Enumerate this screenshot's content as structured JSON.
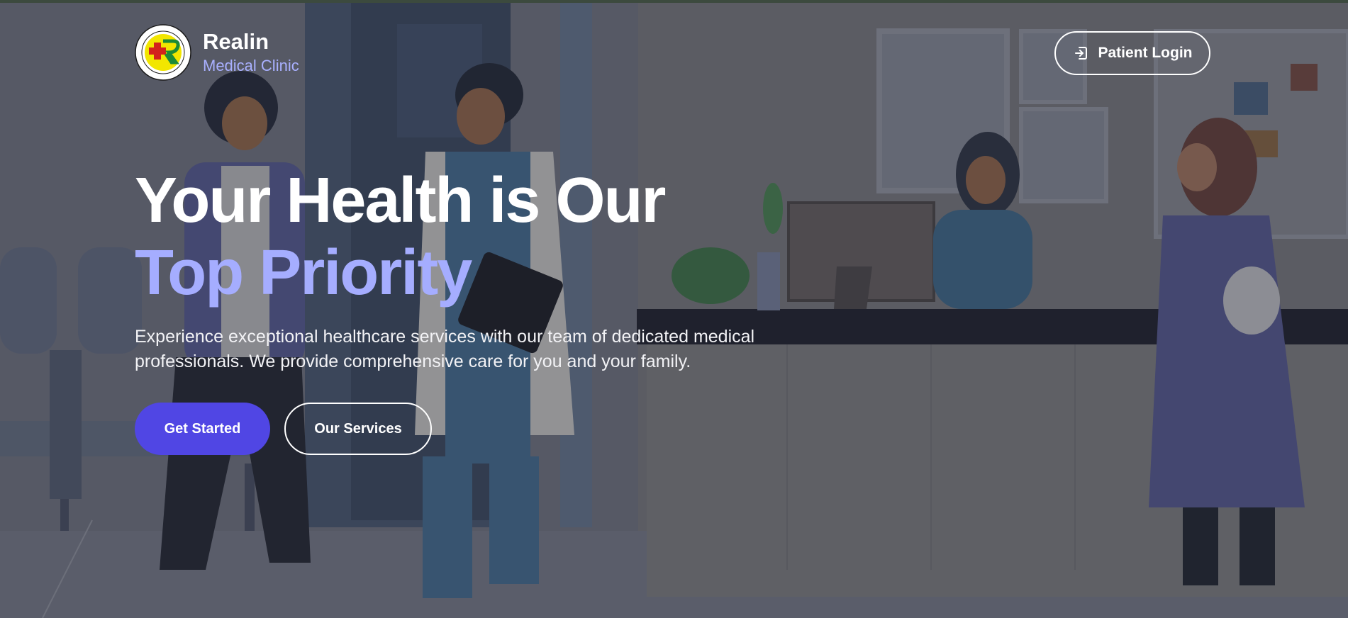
{
  "brand": {
    "name": "Realin",
    "subtitle": "Medical Clinic",
    "logo_text_top": "REALIN MEDICAL CLINIC",
    "logo_year": "2006"
  },
  "header": {
    "login_label": "Patient Login",
    "login_icon": "sign-in-icon"
  },
  "hero": {
    "title_line1": "Your Health is Our",
    "title_line2": "Top Priority",
    "description": "Experience exceptional healthcare services with our team of dedicated medical professionals. We provide comprehensive care for you and your family.",
    "primary_cta": "Get Started",
    "secondary_cta": "Our Services"
  },
  "colors": {
    "accent": "#a5adff",
    "primary_button": "#5046e4",
    "overlay": "#55575f"
  }
}
